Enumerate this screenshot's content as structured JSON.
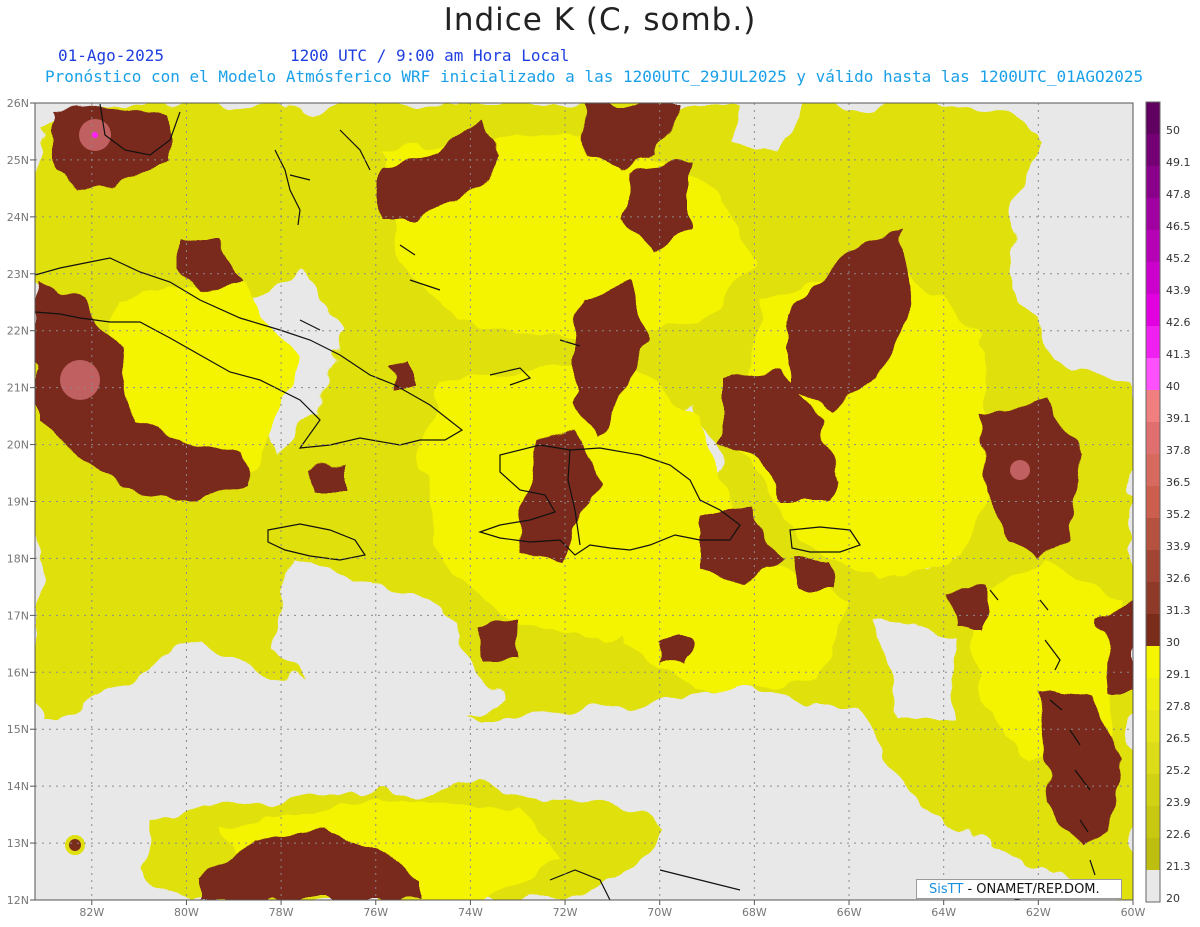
{
  "header": {
    "title": "Indice K (C, somb.)",
    "date": "01-Ago-2025",
    "time": "1200 UTC / 9:00 am Hora Local",
    "forecast": "Pronóstico con el Modelo Atmósferico WRF inicializado a las 1200UTC_29JUL2025 y válido hasta las  1200UTC_01AGO2025"
  },
  "map": {
    "lat_labels": [
      "26N",
      "25N",
      "24N",
      "23N",
      "22N",
      "21N",
      "20N",
      "19N",
      "18N",
      "17N",
      "16N",
      "15N",
      "14N",
      "13N",
      "12N"
    ],
    "lon_labels": [
      "82W",
      "80W",
      "78W",
      "76W",
      "74W",
      "72W",
      "70W",
      "68W",
      "66W",
      "64W",
      "62W",
      "60W"
    ],
    "extent": {
      "lon_min": -83.2,
      "lon_max": -60,
      "lat_min": 12,
      "lat_max": 26
    }
  },
  "legend": {
    "labels": [
      "50",
      "49.1",
      "47.8",
      "46.5",
      "45.2",
      "43.9",
      "42.6",
      "41.3",
      "40",
      "39.1",
      "37.8",
      "36.5",
      "35.2",
      "33.9",
      "32.6",
      "31.3",
      "30",
      "29.1",
      "27.8",
      "26.5",
      "25.2",
      "23.9",
      "22.6",
      "21.3",
      "20"
    ],
    "colors": [
      "#600060",
      "#750075",
      "#8a008a",
      "#a000a0",
      "#b600b6",
      "#cc00cc",
      "#e000e0",
      "#f020f0",
      "#ff50ff",
      "#f08080",
      "#e07070",
      "#d66a5e",
      "#cc5e4e",
      "#b5513f",
      "#a24434",
      "#8f3a28",
      "#7a2c1a",
      "#f5f500",
      "#eded10",
      "#e5e518",
      "#dcdc18",
      "#d2d214",
      "#c8c810",
      "#bebe10",
      "#e8e8e8"
    ]
  },
  "credit": {
    "sistema": "SisTT",
    "org": "- ONAMET/REP.DOM."
  }
}
